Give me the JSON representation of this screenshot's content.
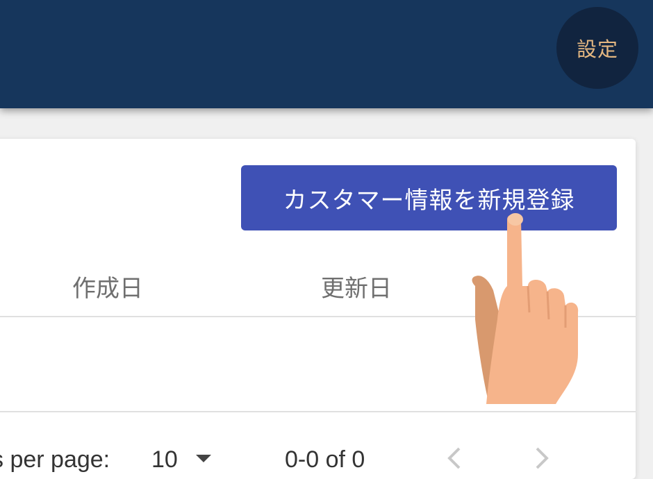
{
  "header": {
    "settings_label": "設定"
  },
  "toolbar": {
    "download_icon": "cloud-download-icon",
    "refresh_icon": "refresh-icon",
    "create_label": "カスタマー情報を新規登録"
  },
  "table": {
    "columns": [
      "作成日",
      "更新日"
    ],
    "rows": []
  },
  "paginator": {
    "rows_per_page_label": "s per page:",
    "page_size": "10",
    "range_label": "0-0 of 0"
  },
  "colors": {
    "appbar": "#16365c",
    "settings_bg": "#11243f",
    "settings_text": "#e4b781",
    "primary": "#3f51b5"
  }
}
